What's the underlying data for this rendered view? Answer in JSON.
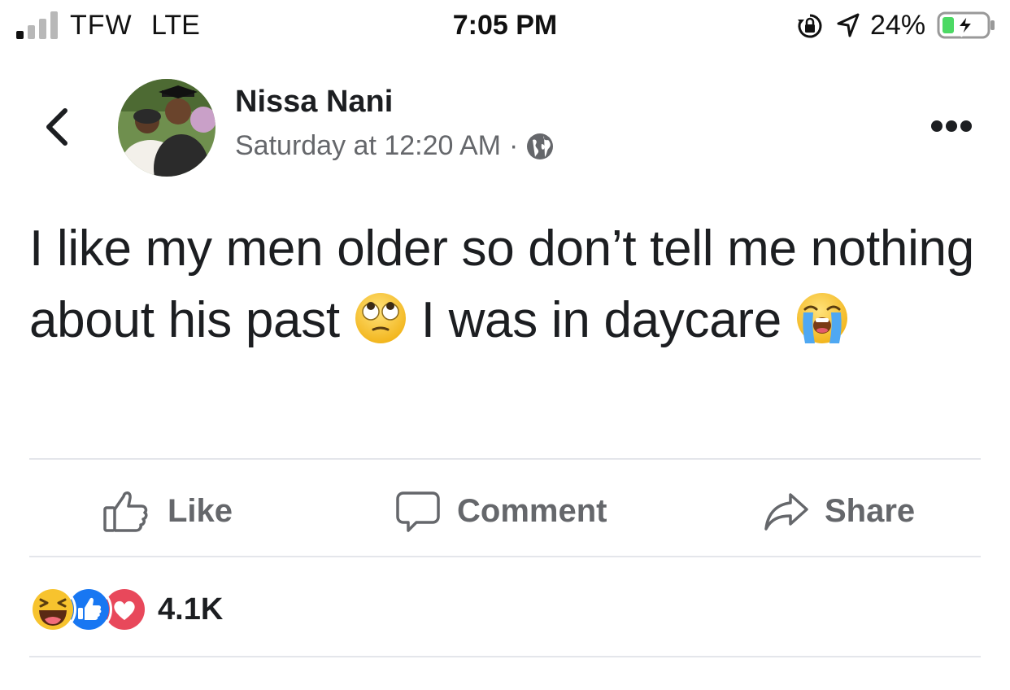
{
  "status_bar": {
    "carrier": "TFW",
    "network": "LTE",
    "time": "7:05 PM",
    "battery_percent": "24%",
    "icons": [
      "signal-icon",
      "lock-rotation-icon",
      "location-icon",
      "battery-charging-icon"
    ]
  },
  "post": {
    "author": "Nissa Nani",
    "timestamp": "Saturday at 12:20 AM",
    "separator": "·",
    "audience_icon": "globe-icon",
    "text_segments": {
      "part1": "I like my men older so don’t tell me nothing about his past",
      "part2": "I was in daycare"
    },
    "emojis": [
      "face-with-rolling-eyes",
      "loudly-crying-face"
    ]
  },
  "actions": {
    "like": "Like",
    "comment": "Comment",
    "share": "Share"
  },
  "reactions": {
    "types": [
      "haha",
      "like",
      "love"
    ],
    "count": "4.1K"
  },
  "colors": {
    "text": "#1c1e21",
    "secondary": "#65676b",
    "divider": "#e4e6eb",
    "like_blue": "#1877f2",
    "love_red": "#e8485b",
    "haha_yellow": "#f7c32e",
    "battery_green": "#4cd964"
  }
}
